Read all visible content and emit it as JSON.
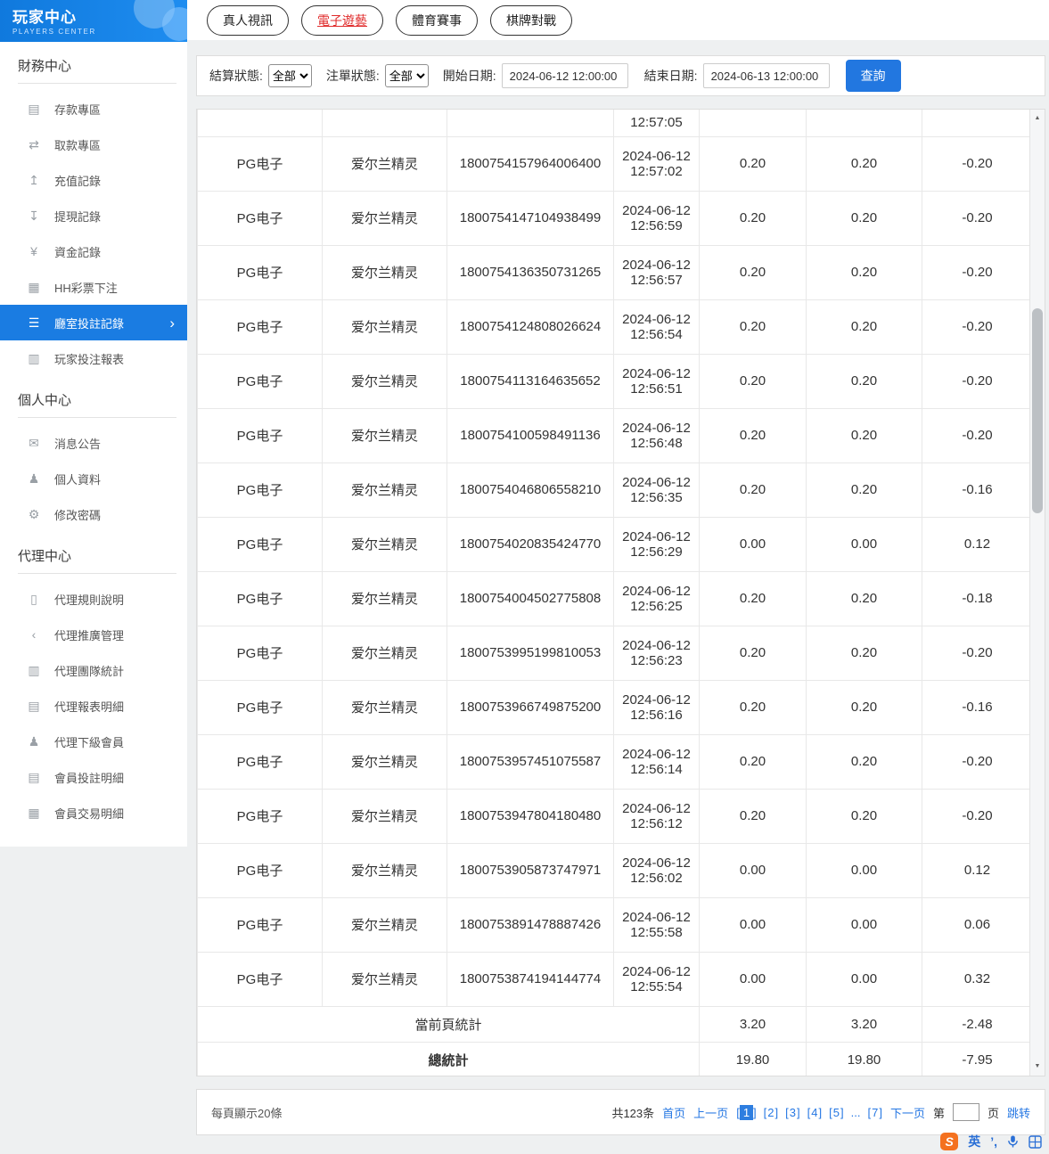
{
  "sidebar": {
    "title": "玩家中心",
    "subtitle": "PLAYERS CENTER",
    "active_chevron": "›",
    "sections": [
      {
        "header": "財務中心",
        "items": [
          {
            "id": "deposit",
            "label": "存款專區",
            "icon": "deposit-icon",
            "glyph": "▤"
          },
          {
            "id": "withdraw",
            "label": "取款專區",
            "icon": "withdraw-icon",
            "glyph": "⇄"
          },
          {
            "id": "recharge-records",
            "label": "充值記錄",
            "icon": "recharge-record-icon",
            "glyph": "↥"
          },
          {
            "id": "withdrawal-records",
            "label": "提現記錄",
            "icon": "withdrawal-record-icon",
            "glyph": "↧"
          },
          {
            "id": "fund-records",
            "label": "資金記錄",
            "icon": "fund-record-icon",
            "glyph": "¥"
          },
          {
            "id": "hh-lottery-bets",
            "label": "HH彩票下注",
            "icon": "lottery-bet-icon",
            "glyph": "▦"
          },
          {
            "id": "room-bet-records",
            "label": "廳室投註記錄",
            "icon": "room-bet-record-icon",
            "glyph": "☰",
            "active": true
          },
          {
            "id": "player-bet-report",
            "label": "玩家投注報表",
            "icon": "player-report-icon",
            "glyph": "▥"
          }
        ]
      },
      {
        "header": "個人中心",
        "items": [
          {
            "id": "announcements",
            "label": "消息公告",
            "icon": "bell-icon",
            "glyph": "✉"
          },
          {
            "id": "profile",
            "label": "個人資料",
            "icon": "user-icon",
            "glyph": "♟"
          },
          {
            "id": "change-password",
            "label": "修改密碼",
            "icon": "gear-icon",
            "glyph": "⚙"
          }
        ]
      },
      {
        "header": "代理中心",
        "items": [
          {
            "id": "agent-rules",
            "label": "代理規則說明",
            "icon": "document-icon",
            "glyph": "▯"
          },
          {
            "id": "agent-promotion",
            "label": "代理推廣管理",
            "icon": "share-icon",
            "glyph": "‹"
          },
          {
            "id": "agent-team-stats",
            "label": "代理團隊統計",
            "icon": "team-stats-icon",
            "glyph": "▥"
          },
          {
            "id": "agent-report-details",
            "label": "代理報表明細",
            "icon": "report-detail-icon",
            "glyph": "▤"
          },
          {
            "id": "agent-sub-members",
            "label": "代理下級會員",
            "icon": "members-icon",
            "glyph": "♟"
          },
          {
            "id": "member-bet-details",
            "label": "會員投註明細",
            "icon": "member-bet-icon",
            "glyph": "▤"
          },
          {
            "id": "member-transaction-details",
            "label": "會員交易明細",
            "icon": "member-transaction-icon",
            "glyph": "▦"
          }
        ]
      }
    ]
  },
  "tabs": [
    {
      "id": "live-video",
      "label": "真人視訊",
      "active": false
    },
    {
      "id": "electronic-games",
      "label": "電子遊藝",
      "active": true
    },
    {
      "id": "sports",
      "label": "體育賽事",
      "active": false
    },
    {
      "id": "chess-cards",
      "label": "棋牌對戰",
      "active": false
    }
  ],
  "filters": {
    "settle_label": "結算狀態:",
    "settle_value": "全部",
    "order_label": "注單狀態:",
    "order_value": "全部",
    "start_label": "開始日期:",
    "start_value": "2024-06-12 12:00:00",
    "end_label": "結束日期:",
    "end_value": "2024-06-13 12:00:00",
    "search_label": "查詢"
  },
  "table": {
    "partial_row": {
      "time": "12:57:05"
    },
    "rows": [
      {
        "platform": "PG电子",
        "game": "爱尔兰精灵",
        "bet_no": "1800754157964006400",
        "date": "2024-06-12",
        "time": "12:57:02",
        "bet": "0.20",
        "valid": "0.20",
        "profit": "-0.20"
      },
      {
        "platform": "PG电子",
        "game": "爱尔兰精灵",
        "bet_no": "1800754147104938499",
        "date": "2024-06-12",
        "time": "12:56:59",
        "bet": "0.20",
        "valid": "0.20",
        "profit": "-0.20"
      },
      {
        "platform": "PG电子",
        "game": "爱尔兰精灵",
        "bet_no": "1800754136350731265",
        "date": "2024-06-12",
        "time": "12:56:57",
        "bet": "0.20",
        "valid": "0.20",
        "profit": "-0.20"
      },
      {
        "platform": "PG电子",
        "game": "爱尔兰精灵",
        "bet_no": "1800754124808026624",
        "date": "2024-06-12",
        "time": "12:56:54",
        "bet": "0.20",
        "valid": "0.20",
        "profit": "-0.20"
      },
      {
        "platform": "PG电子",
        "game": "爱尔兰精灵",
        "bet_no": "1800754113164635652",
        "date": "2024-06-12",
        "time": "12:56:51",
        "bet": "0.20",
        "valid": "0.20",
        "profit": "-0.20"
      },
      {
        "platform": "PG电子",
        "game": "爱尔兰精灵",
        "bet_no": "1800754100598491136",
        "date": "2024-06-12",
        "time": "12:56:48",
        "bet": "0.20",
        "valid": "0.20",
        "profit": "-0.20"
      },
      {
        "platform": "PG电子",
        "game": "爱尔兰精灵",
        "bet_no": "1800754046806558210",
        "date": "2024-06-12",
        "time": "12:56:35",
        "bet": "0.20",
        "valid": "0.20",
        "profit": "-0.16"
      },
      {
        "platform": "PG电子",
        "game": "爱尔兰精灵",
        "bet_no": "1800754020835424770",
        "date": "2024-06-12",
        "time": "12:56:29",
        "bet": "0.00",
        "valid": "0.00",
        "profit": "0.12"
      },
      {
        "platform": "PG电子",
        "game": "爱尔兰精灵",
        "bet_no": "1800754004502775808",
        "date": "2024-06-12",
        "time": "12:56:25",
        "bet": "0.20",
        "valid": "0.20",
        "profit": "-0.18"
      },
      {
        "platform": "PG电子",
        "game": "爱尔兰精灵",
        "bet_no": "1800753995199810053",
        "date": "2024-06-12",
        "time": "12:56:23",
        "bet": "0.20",
        "valid": "0.20",
        "profit": "-0.20"
      },
      {
        "platform": "PG电子",
        "game": "爱尔兰精灵",
        "bet_no": "1800753966749875200",
        "date": "2024-06-12",
        "time": "12:56:16",
        "bet": "0.20",
        "valid": "0.20",
        "profit": "-0.16"
      },
      {
        "platform": "PG电子",
        "game": "爱尔兰精灵",
        "bet_no": "1800753957451075587",
        "date": "2024-06-12",
        "time": "12:56:14",
        "bet": "0.20",
        "valid": "0.20",
        "profit": "-0.20"
      },
      {
        "platform": "PG电子",
        "game": "爱尔兰精灵",
        "bet_no": "1800753947804180480",
        "date": "2024-06-12",
        "time": "12:56:12",
        "bet": "0.20",
        "valid": "0.20",
        "profit": "-0.20"
      },
      {
        "platform": "PG电子",
        "game": "爱尔兰精灵",
        "bet_no": "1800753905873747971",
        "date": "2024-06-12",
        "time": "12:56:02",
        "bet": "0.00",
        "valid": "0.00",
        "profit": "0.12"
      },
      {
        "platform": "PG电子",
        "game": "爱尔兰精灵",
        "bet_no": "1800753891478887426",
        "date": "2024-06-12",
        "time": "12:55:58",
        "bet": "0.00",
        "valid": "0.00",
        "profit": "0.06"
      },
      {
        "platform": "PG电子",
        "game": "爱尔兰精灵",
        "bet_no": "1800753874194144774",
        "date": "2024-06-12",
        "time": "12:55:54",
        "bet": "0.00",
        "valid": "0.00",
        "profit": "0.32"
      }
    ],
    "page_total": {
      "label": "當前頁統計",
      "bet": "3.20",
      "valid": "3.20",
      "profit": "-2.48"
    },
    "grand_total": {
      "label": "總統計",
      "bet": "19.80",
      "valid": "19.80",
      "profit": "-7.95"
    }
  },
  "scrollbar": {
    "up_glyph": "▲",
    "down_glyph": "▼"
  },
  "pagination": {
    "per_page": "每頁顯示20條",
    "total": "共123条",
    "first": "首页",
    "prev": "上一页",
    "pages": [
      "1",
      "2",
      "3",
      "4",
      "5"
    ],
    "ellipsis": "...",
    "last_page": "7",
    "next": "下一页",
    "jump_prefix": "第",
    "jump_suffix": "页",
    "jump_action": "跳转",
    "current": "1"
  },
  "ime": {
    "logo": "S",
    "lang": "英",
    "punct": "’,"
  }
}
